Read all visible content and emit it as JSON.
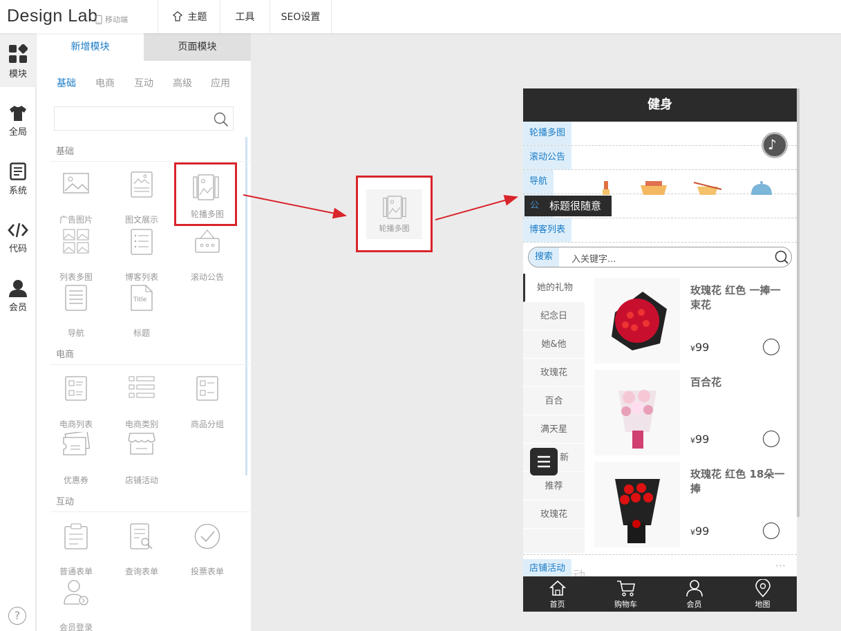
{
  "app": {
    "logo": "Design Lab",
    "mobile_label": "移动端"
  },
  "top_menu": [
    {
      "label": "主题",
      "icon": "theme-icon"
    },
    {
      "label": "工具"
    },
    {
      "label": "SEO设置"
    }
  ],
  "rail": [
    {
      "label": "模块",
      "icon": "modules-icon"
    },
    {
      "label": "全局",
      "icon": "shirt-icon"
    },
    {
      "label": "系统",
      "icon": "document-icon"
    },
    {
      "label": "代码",
      "icon": "code-icon"
    },
    {
      "label": "会员",
      "icon": "user-icon"
    }
  ],
  "help": "?",
  "panel": {
    "tabs": [
      "新增模块",
      "页面模块"
    ],
    "subtabs": [
      "基础",
      "电商",
      "互动",
      "高级",
      "应用"
    ],
    "search_placeholder": "",
    "sections": {
      "basic": {
        "title": "基础",
        "items": [
          "广告图片",
          "图文展示",
          "轮播多图",
          "列表多图",
          "博客列表",
          "滚动公告",
          "导航",
          "标题"
        ]
      },
      "ecommerce": {
        "title": "电商",
        "items": [
          "电商列表",
          "电商类别",
          "商品分组",
          "优惠券",
          "店铺活动"
        ]
      },
      "interactive": {
        "title": "互动",
        "items": [
          "普通表单",
          "查询表单",
          "投票表单",
          "会员登录"
        ]
      }
    }
  },
  "drag_preview": {
    "label": "轮播多图"
  },
  "phone": {
    "header": "健身",
    "rows": [
      "轮播多图",
      "滚动公告",
      "导航",
      "标题",
      "博客列表"
    ],
    "title_tooltip": "标题很随意",
    "title_tooltip_overlap": "公",
    "search": {
      "tag": "搜索",
      "placeholder": "入关键字..."
    },
    "categories": [
      "她的礼物",
      "纪念日",
      "她&他",
      "玫瑰花",
      "百合",
      "满天星",
      "新",
      "推荐",
      "玫瑰花"
    ],
    "products": [
      {
        "name": "玫瑰花 红色 一捧一束花",
        "currency": "¥",
        "price": "99"
      },
      {
        "name": "百合花",
        "currency": "¥",
        "price": "99"
      },
      {
        "name": "玫瑰花 红色 18朵一捧",
        "currency": "¥",
        "price": "99"
      }
    ],
    "shop_tag": "店铺活动",
    "shop_ghost": "店铺活动",
    "shop_more": "···",
    "footer": [
      {
        "label": "首页",
        "icon": "home-icon"
      },
      {
        "label": "购物车",
        "icon": "cart-icon"
      },
      {
        "label": "会员",
        "icon": "user-icon"
      },
      {
        "label": "地图",
        "icon": "map-pin-icon"
      }
    ]
  },
  "colors": {
    "accent": "#1b7bc6",
    "highlight": "#d9242b",
    "dark": "#2b2b2b"
  }
}
